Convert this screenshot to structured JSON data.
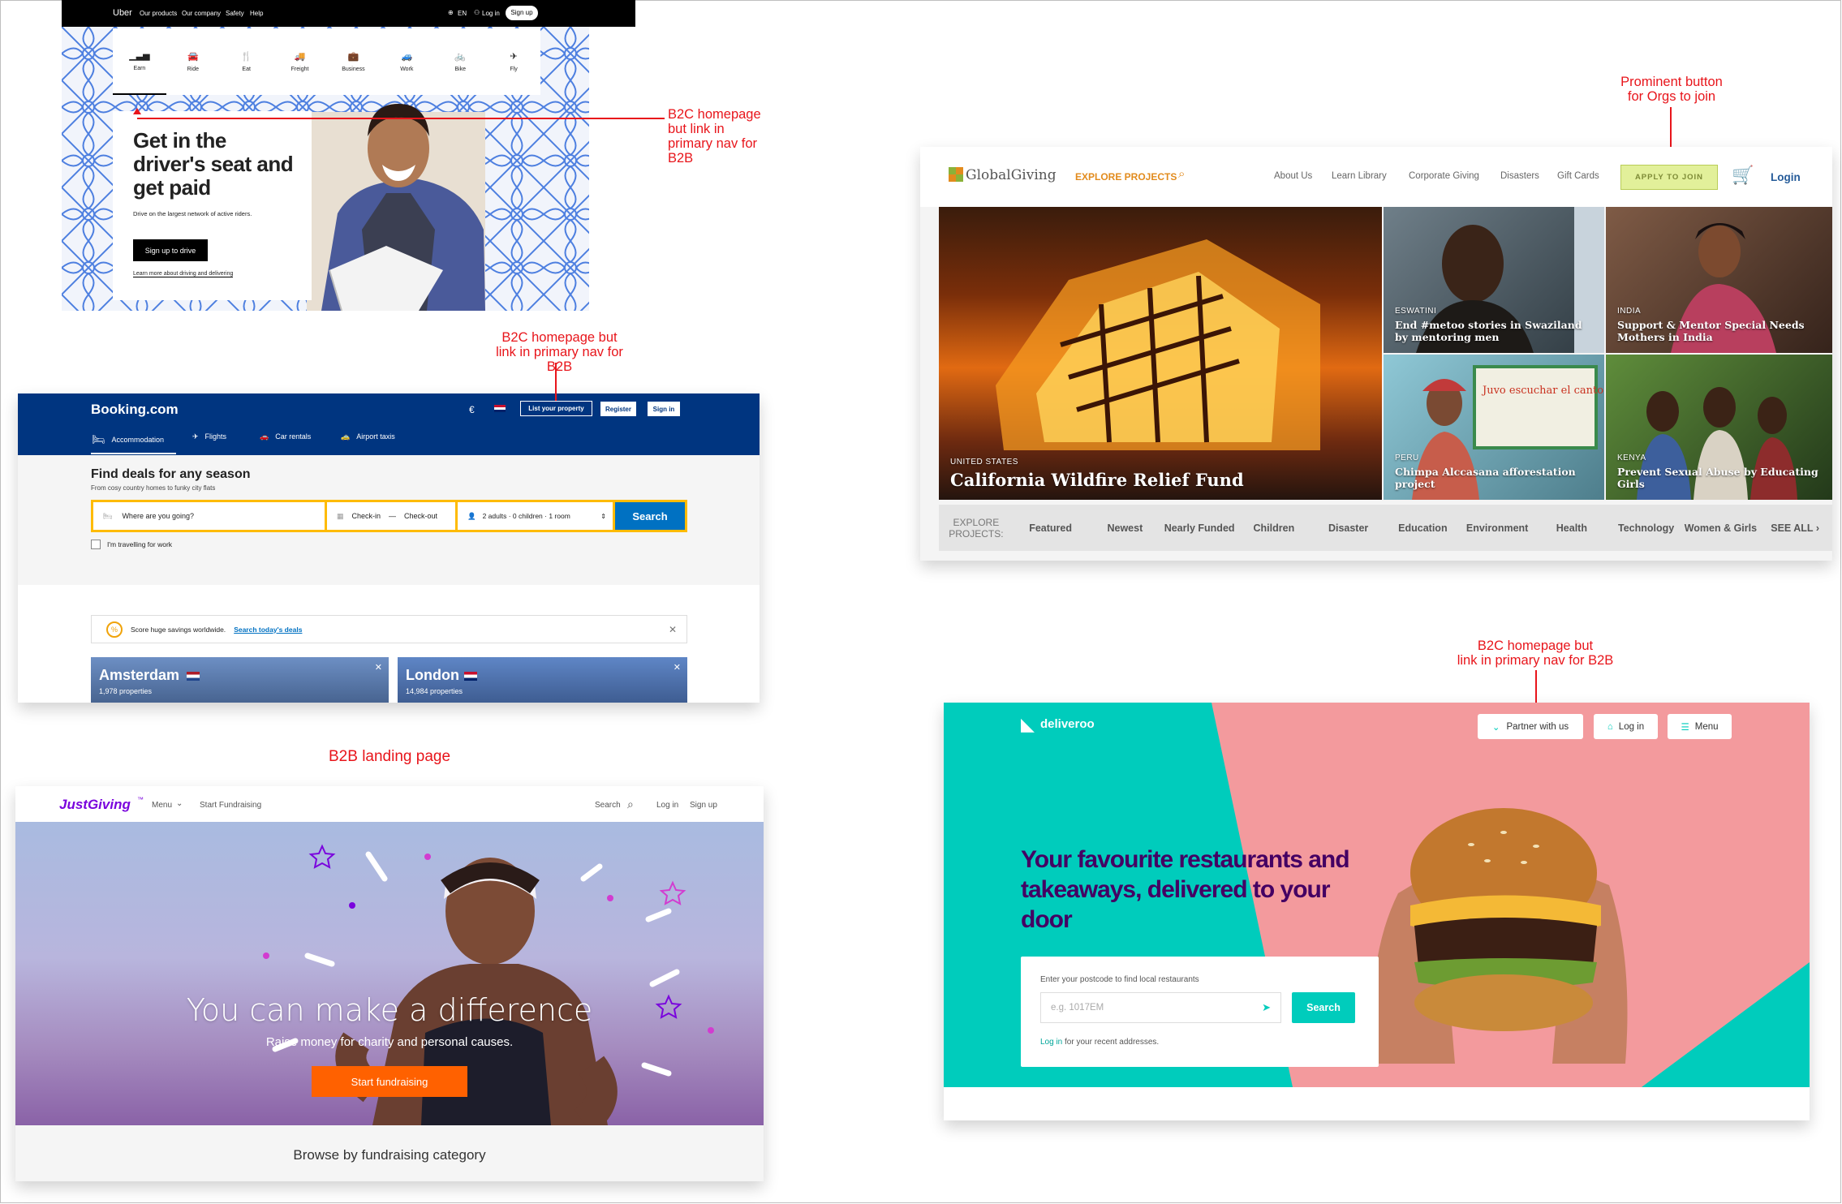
{
  "annotations": {
    "uber_note": "B2C homepage\nbut link in\nprimary nav for\nB2B",
    "booking_note": "B2C homepage but\nlink in primary nav for B2B",
    "justgiving_note": "B2B landing page",
    "globalgiving_note": "Prominent button\nfor Orgs to join",
    "deliveroo_note": "B2C homepage but\nlink in primary nav for B2B"
  },
  "uber": {
    "logo": "Uber",
    "nav": [
      "Our products",
      "Our company",
      "Safety",
      "Help"
    ],
    "lang": "EN",
    "login": "Log in",
    "signup": "Sign up",
    "categories": [
      "Earn",
      "Ride",
      "Eat",
      "Freight",
      "Business",
      "Work",
      "Bike",
      "Fly"
    ],
    "headline": "Get in the driver's seat and get paid",
    "subtext": "Drive on the largest network of active riders.",
    "cta": "Sign up to drive",
    "link": "Learn more about driving and delivering"
  },
  "booking": {
    "logo": "Booking.com",
    "currency": "€",
    "list_property": "List your property",
    "register": "Register",
    "signin": "Sign in",
    "tabs": [
      "Accommodation",
      "Flights",
      "Car rentals",
      "Airport taxis"
    ],
    "heading": "Find deals for any season",
    "subheading": "From cosy country homes to funky city flats",
    "destination_placeholder": "Where are you going?",
    "checkin": "Check-in",
    "dash": "—",
    "checkout": "Check-out",
    "guests": "2 adults · 0 children · 1 room",
    "search": "Search",
    "work_travel": "I'm travelling for work",
    "promo_text": "Score huge savings worldwide.",
    "promo_link": "Search today's deals",
    "cities": [
      {
        "name": "Amsterdam",
        "props": "1,978 properties"
      },
      {
        "name": "London",
        "props": "14,984 properties"
      }
    ]
  },
  "justgiving": {
    "logo": "JustGiving",
    "logo_tm": "™",
    "menu": "Menu",
    "start": "Start Fundraising",
    "search": "Search",
    "login": "Log in",
    "signup": "Sign up",
    "headline": "You can make a difference",
    "subline": "Raise money for charity and personal causes.",
    "cta": "Start fundraising",
    "browse": "Browse by fundraising category"
  },
  "globalgiving": {
    "logo": "GlobalGiving",
    "explore": "EXPLORE PROJECTS",
    "nav": [
      "About Us",
      "Learn Library",
      "Corporate Giving",
      "Disasters",
      "Gift Cards"
    ],
    "apply": "APPLY TO JOIN",
    "login": "Login",
    "main_country": "UNITED STATES",
    "main_title": "California Wildfire Relief Fund",
    "tiles": [
      {
        "country": "ESWATINI",
        "title": "End #metoo stories in Swaziland by mentoring men"
      },
      {
        "country": "INDIA",
        "title": "Support & Mentor Special Needs Mothers in India"
      },
      {
        "country": "PERU",
        "title": "Chimpa Alccasana afforestation project"
      },
      {
        "country": "KENYA",
        "title": "Prevent Sexual Abuse by Educating Girls"
      }
    ],
    "sign_text": "Juvo escuchar el canto de los pajaros",
    "bar_label": "EXPLORE PROJECTS:",
    "bar_items": [
      "Featured",
      "Newest",
      "Nearly Funded",
      "Children",
      "Disaster",
      "Education",
      "Environment",
      "Health",
      "Technology",
      "Women & Girls",
      "SEE ALL ›"
    ]
  },
  "deliveroo": {
    "logo": "deliveroo",
    "partner": "Partner with us",
    "login": "Log in",
    "menu": "Menu",
    "headline": "Your favourite restaurants and takeaways, delivered to your door",
    "postcode_label": "Enter your postcode to find local restaurants",
    "postcode_placeholder": "e.g. 1017EM",
    "search": "Search",
    "login_link": "Log in",
    "login_suffix": " for your recent addresses."
  },
  "colors": {
    "annotation_red": "#e8151b",
    "booking_blue": "#003580",
    "booking_yellow": "#febb02",
    "booking_button": "#0071c2",
    "justgiving_purple": "#7a04dd",
    "justgiving_orange": "#ff6100",
    "globalgiving_orange": "#e28b1d",
    "globalgiving_apply": "#e2f09a",
    "deliveroo_teal": "#00ccbc",
    "deliveroo_pink": "#f39a9d",
    "deliveroo_purple": "#440063"
  }
}
